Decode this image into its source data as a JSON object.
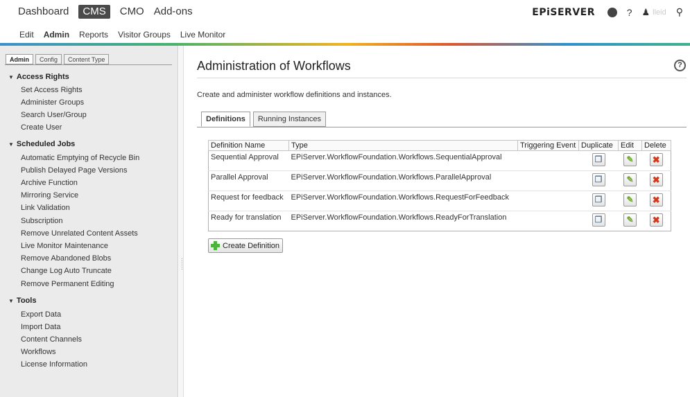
{
  "topnav": {
    "items": [
      "Dashboard",
      "CMS",
      "CMO",
      "Add-ons"
    ],
    "active_index": 1,
    "brand": "EPiSERVER",
    "help": "?",
    "username": "lleid"
  },
  "subnav": {
    "items": [
      "Edit",
      "Admin",
      "Reports",
      "Visitor Groups",
      "Live Monitor"
    ],
    "active_index": 1
  },
  "left": {
    "tabs": [
      "Admin",
      "Config",
      "Content Type"
    ],
    "sections": [
      {
        "title": "Access Rights",
        "items": [
          "Set Access Rights",
          "Administer Groups",
          "Search User/Group",
          "Create User"
        ]
      },
      {
        "title": "Scheduled Jobs",
        "items": [
          "Automatic Emptying of Recycle Bin",
          "Publish Delayed Page Versions",
          "Archive Function",
          "Mirroring Service",
          "Link Validation",
          "Subscription",
          "Remove Unrelated Content Assets",
          "Live Monitor Maintenance",
          "Remove Abandoned Blobs",
          "Change Log Auto Truncate",
          "Remove Permanent Editing"
        ]
      },
      {
        "title": "Tools",
        "items": [
          "Export Data",
          "Import Data",
          "Content Channels",
          "Workflows",
          "License Information"
        ]
      }
    ]
  },
  "main": {
    "title": "Administration of Workflows",
    "description": "Create and administer workflow definitions and instances.",
    "tabs": [
      "Definitions",
      "Running Instances"
    ],
    "table": {
      "headers": [
        "Definition Name",
        "Type",
        "Triggering Event",
        "Duplicate",
        "Edit",
        "Delete"
      ],
      "rows": [
        {
          "name": "Sequential Approval",
          "type": "EPiServer.WorkflowFoundation.Workflows.SequentialApproval",
          "event": ""
        },
        {
          "name": "Parallel Approval",
          "type": "EPiServer.WorkflowFoundation.Workflows.ParallelApproval",
          "event": ""
        },
        {
          "name": "Request for feedback",
          "type": "EPiServer.WorkflowFoundation.Workflows.RequestForFeedback",
          "event": ""
        },
        {
          "name": "Ready for translation",
          "type": "EPiServer.WorkflowFoundation.Workflows.ReadyForTranslation",
          "event": ""
        }
      ]
    },
    "create_button": "Create Definition"
  }
}
